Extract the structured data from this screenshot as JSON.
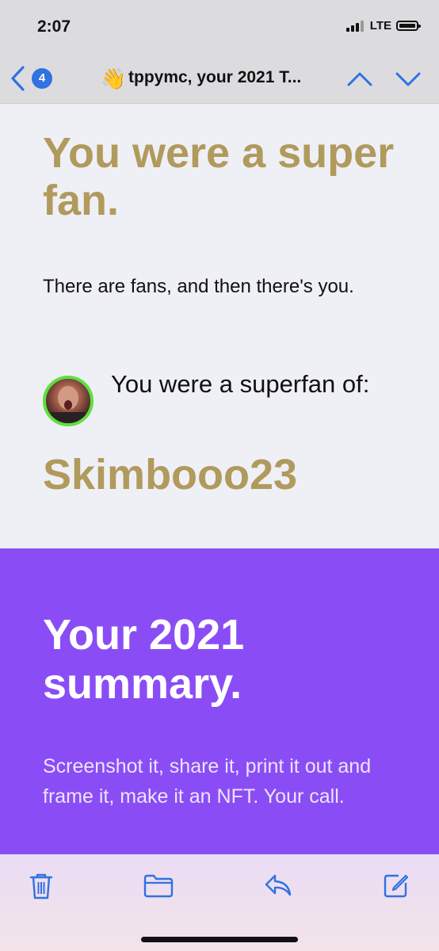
{
  "status_bar": {
    "time": "2:07",
    "network": "LTE"
  },
  "nav": {
    "back_badge_count": "4",
    "subject_emoji": "👋",
    "subject": "tppymc, your 2021 T..."
  },
  "fan_section": {
    "headline": "You were a super fan.",
    "tagline": "There are fans, and then there's you.",
    "superfan_label": "You were a superfan of:",
    "superfan_name": "Skimbooo23"
  },
  "summary_section": {
    "title": "Your 2021 summary.",
    "text": "Screenshot it, share it, print it out and frame it, make it an NFT. Your call."
  },
  "toolbar": {
    "icons": [
      "trash-icon",
      "folder-icon",
      "reply-icon",
      "compose-icon"
    ]
  },
  "colors": {
    "accent_blue": "#2f72e0",
    "gold": "#b09a5c",
    "purple": "#8a4df5",
    "avatar_ring": "#5de03f"
  }
}
